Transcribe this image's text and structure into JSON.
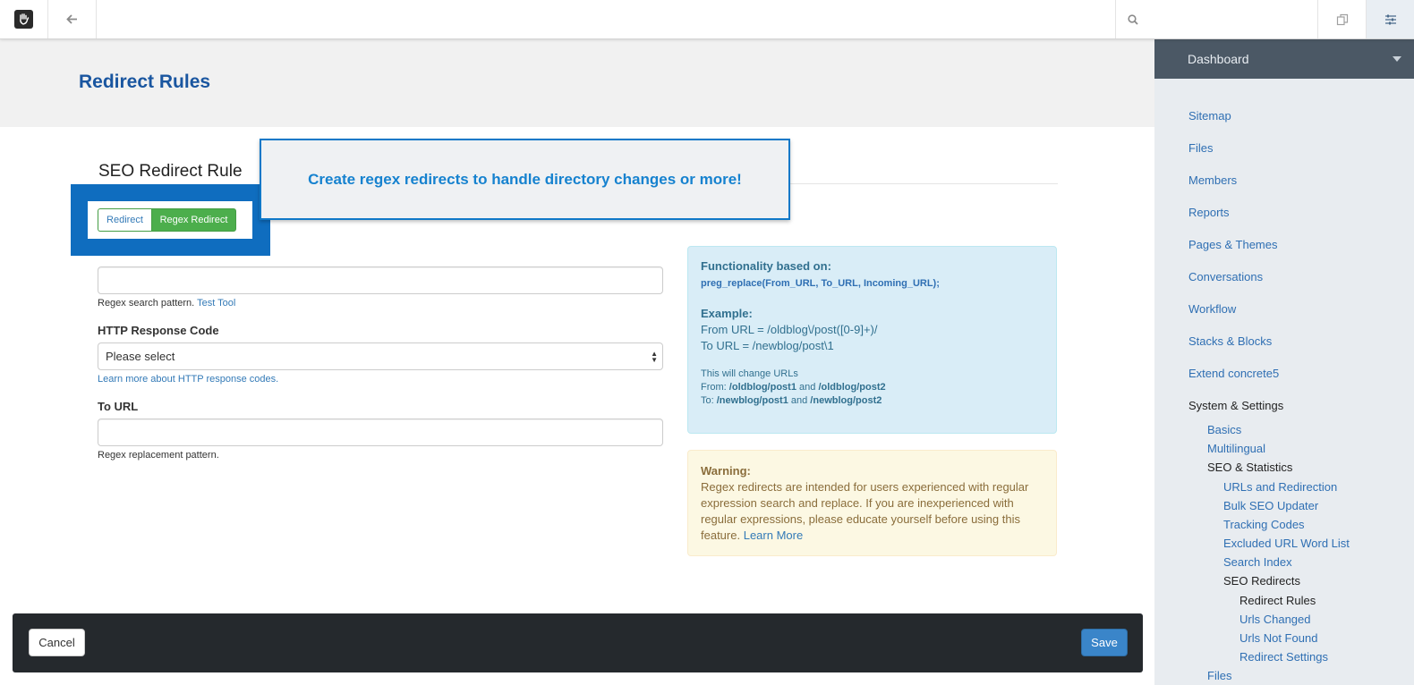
{
  "page": {
    "title": "Redirect Rules"
  },
  "form": {
    "section_title": "SEO Redirect Rule",
    "toggle": {
      "redirect_label": "Redirect",
      "regex_label": "Regex Redirect"
    },
    "callout_text": "Create regex redirects to handle directory changes or more!",
    "from_url": {
      "value": "",
      "help_text": "Regex search pattern.",
      "help_link": "Test Tool"
    },
    "http_code": {
      "label": "HTTP Response Code",
      "selected": "Please select",
      "help_link": "Learn more about HTTP response codes."
    },
    "to_url": {
      "label": "To URL",
      "value": "",
      "help_text": "Regex replacement pattern."
    }
  },
  "info_box": {
    "heading": "Functionality based on:",
    "code": "preg_replace(From_URL, To_URL, Incoming_URL);",
    "example_heading": "Example:",
    "from_line": "From URL = /oldblog\\/post([0-9]+)/",
    "to_line": "To URL = /newblog/post\\1",
    "change_intro": "This will change URLs",
    "from_prefix": "From:",
    "from_a": "/oldblog/post1",
    "and1": "and",
    "from_b": "/oldblog/post2",
    "to_prefix": "To:",
    "to_a": "/newblog/post1",
    "and2": "and",
    "to_b": "/newblog/post2"
  },
  "warning_box": {
    "heading": "Warning:",
    "body": "Regex redirects are intended for users experienced with regular expression search and replace. If you are inexperienced with regular expressions, please educate yourself before using this feature.",
    "link": "Learn More"
  },
  "footer": {
    "cancel_label": "Cancel",
    "save_label": "Save"
  },
  "sidebar": {
    "header": "Dashboard",
    "items": [
      {
        "label": "Sitemap"
      },
      {
        "label": "Files"
      },
      {
        "label": "Members"
      },
      {
        "label": "Reports"
      },
      {
        "label": "Pages & Themes"
      },
      {
        "label": "Conversations"
      },
      {
        "label": "Workflow"
      },
      {
        "label": "Stacks & Blocks"
      },
      {
        "label": "Extend concrete5"
      },
      {
        "label": "System & Settings"
      },
      {
        "label": "Basics"
      },
      {
        "label": "Multilingual"
      },
      {
        "label": "SEO & Statistics"
      },
      {
        "label": "URLs and Redirection"
      },
      {
        "label": "Bulk SEO Updater"
      },
      {
        "label": "Tracking Codes"
      },
      {
        "label": "Excluded URL Word List"
      },
      {
        "label": "Search Index"
      },
      {
        "label": "SEO Redirects"
      },
      {
        "label": "Redirect Rules"
      },
      {
        "label": "Urls Changed"
      },
      {
        "label": "Urls Not Found"
      },
      {
        "label": "Redirect Settings"
      },
      {
        "label": "Files"
      }
    ]
  },
  "icons": {
    "logo": "concrete5-hand-logo",
    "back": "arrow-left-icon",
    "search": "search-icon",
    "intelligent_search": "pages-icon",
    "panel": "sliders-icon"
  }
}
